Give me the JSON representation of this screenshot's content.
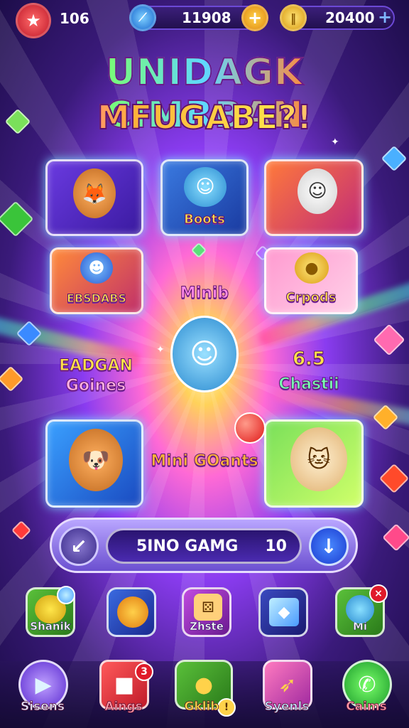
{
  "top_bar": {
    "left_count": "106",
    "gems_value": "11908",
    "coins_value": "20400",
    "add_symbol": "+"
  },
  "title": {
    "line1": "UNIDAGK CIMRBAN",
    "line2": "MFUGABE?!"
  },
  "cards": [
    {
      "label": ""
    },
    {
      "label": "Boots"
    },
    {
      "label": ""
    },
    {
      "label": "EBSDABS"
    },
    {
      "label": "Crpods"
    },
    {
      "label": ""
    },
    {
      "label": ""
    }
  ],
  "floating_labels": {
    "minib": "Minib",
    "eadgan": "EADGAN",
    "goines": "Goines",
    "chastii": "Chastii",
    "mini_goants": "Mini GOants",
    "numbers": "6.5"
  },
  "search": {
    "text": "5INO GAMG",
    "count": "10"
  },
  "tiles": [
    {
      "label": "Shanik"
    },
    {
      "label": ""
    },
    {
      "label": "Zhste"
    },
    {
      "label": ""
    },
    {
      "label": "Mi"
    }
  ],
  "tile_badge": "×",
  "nav": [
    {
      "label": "Sisens",
      "icon": "play-icon"
    },
    {
      "label": "Aings",
      "icon": "gift-icon"
    },
    {
      "label": "Gklib",
      "icon": "medal-icon"
    },
    {
      "label": "Syenls",
      "icon": "rocket-icon"
    },
    {
      "label": "Caims",
      "icon": "phone-icon"
    }
  ],
  "nav_badges": {
    "aings": "3",
    "gklib": "!"
  },
  "colors": {
    "accent_yellow": "#ffe14a",
    "accent_pink": "#ff5bd0",
    "purple_bg": "#3a1a7a"
  }
}
